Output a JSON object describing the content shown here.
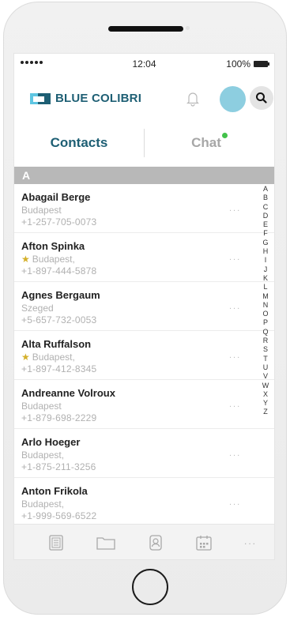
{
  "status_bar": {
    "time": "12:04",
    "battery_percent": "100%"
  },
  "app": {
    "title": "BLUE COLIBRI",
    "brand_color": "#1e5f74",
    "accent_color": "#5ec6e2"
  },
  "tabs": [
    {
      "label": "Contacts",
      "active": true
    },
    {
      "label": "Chat",
      "has_unread_dot": true,
      "dot_color": "#42c24a"
    }
  ],
  "section": {
    "letter": "A"
  },
  "contacts": [
    {
      "name": "Abagail Berge",
      "city": "Budapest",
      "phone": "+1-257-705-0073",
      "favorite": false
    },
    {
      "name": "Afton Spinka",
      "city": "Budapest,",
      "phone": "+1-897-444-5878",
      "favorite": true
    },
    {
      "name": "Agnes Bergaum",
      "city": "Szeged",
      "phone": "+5-657-732-0053",
      "favorite": false
    },
    {
      "name": "Alta Ruffalson",
      "city": "Budapest,",
      "phone": "+1-897-412-8345",
      "favorite": true
    },
    {
      "name": "Andreanne Volroux",
      "city": "Budapest",
      "phone": "+1-879-698-2229",
      "favorite": false
    },
    {
      "name": "Arlo Hoeger",
      "city": "Budapest,",
      "phone": "+1-875-211-3256",
      "favorite": false
    },
    {
      "name": "Anton Frikola",
      "city": "Budapest,",
      "phone": "+1-999-569-6522",
      "favorite": false
    }
  ],
  "row_more": "...",
  "alphabet": [
    "A",
    "B",
    "C",
    "D",
    "E",
    "F",
    "G",
    "H",
    "I",
    "J",
    "K",
    "L",
    "M",
    "N",
    "O",
    "P",
    "Q",
    "R",
    "S",
    "T",
    "U",
    "V",
    "W",
    "X",
    "Y",
    "Z"
  ],
  "bottom_nav": [
    "notes-icon",
    "folder-icon",
    "contact-card-icon",
    "calendar-icon",
    "more-icon"
  ],
  "bottom_more": "..."
}
